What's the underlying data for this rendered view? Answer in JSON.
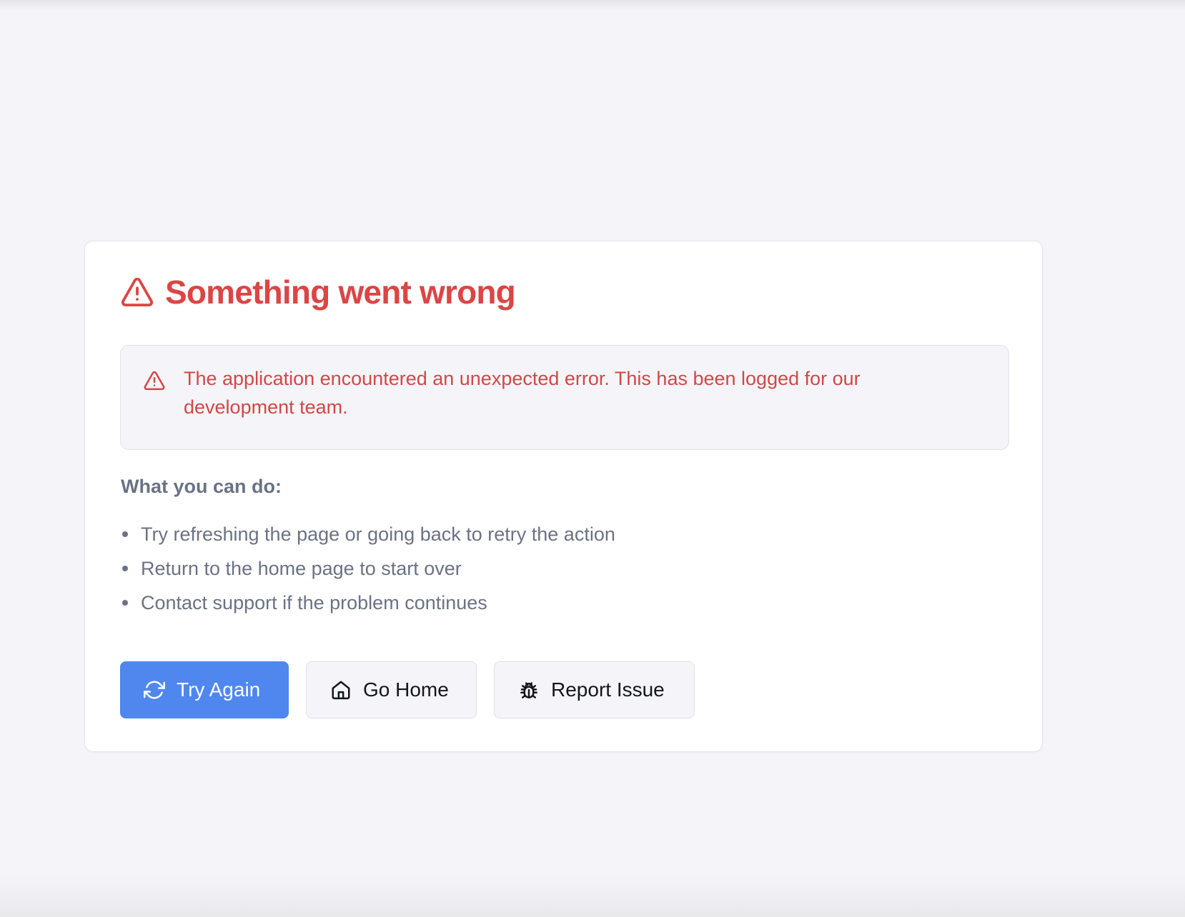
{
  "error_card": {
    "title": "Something went wrong",
    "title_icon": "alert-triangle-icon",
    "alert": {
      "icon": "alert-triangle-icon",
      "message": "The application encountered an unexpected error. This has been logged for our development team."
    },
    "help_heading": "What you can do:",
    "suggestions": [
      "Try refreshing the page or going back to retry the action",
      "Return to the home page to start over",
      "Contact support if the problem continues"
    ],
    "actions": {
      "try_again": {
        "label": "Try Again",
        "icon": "refresh-icon"
      },
      "go_home": {
        "label": "Go Home",
        "icon": "home-icon"
      },
      "report_issue": {
        "label": "Report Issue",
        "icon": "bug-icon"
      }
    }
  },
  "colors": {
    "page_background": "#f5f5f9",
    "error_red": "#dc4545",
    "primary_blue": "#4f87ee",
    "muted_text": "#6a7284"
  }
}
